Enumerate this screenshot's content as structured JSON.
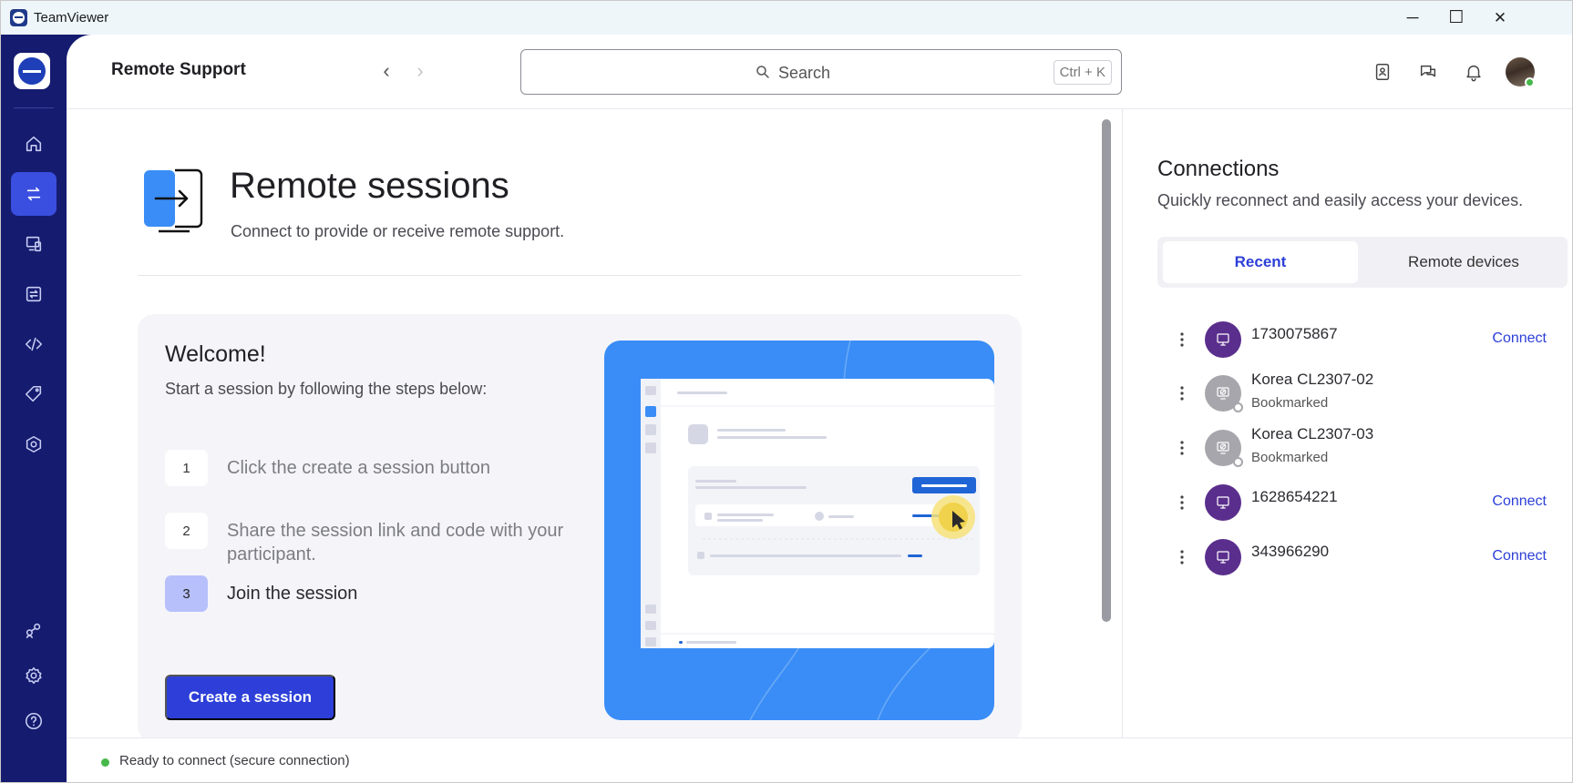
{
  "window": {
    "app_title": "TeamViewer",
    "minimize_glyph": "─",
    "maximize_glyph": "☐",
    "close_glyph": "✕"
  },
  "header": {
    "page_title": "Remote Support",
    "back_glyph": "‹",
    "forward_glyph": "›",
    "search_placeholder": "Search",
    "search_shortcut": "Ctrl + K"
  },
  "nav": {
    "items": [
      {
        "name": "home-icon",
        "active": false
      },
      {
        "name": "remote-support-icon",
        "active": true
      },
      {
        "name": "devices-icon",
        "active": false
      },
      {
        "name": "remote-access-icon",
        "active": false
      },
      {
        "name": "code-icon",
        "active": false
      },
      {
        "name": "tag-icon",
        "active": false
      },
      {
        "name": "security-icon",
        "active": false
      },
      {
        "name": "integrations-icon",
        "active": false
      },
      {
        "name": "settings-icon",
        "active": false
      },
      {
        "name": "help-icon",
        "active": false
      }
    ]
  },
  "hero": {
    "title": "Remote sessions",
    "subtitle": "Connect to provide or receive remote support."
  },
  "welcome": {
    "title": "Welcome!",
    "subtitle": "Start a session by following the steps below:",
    "steps": [
      {
        "number": "1",
        "text": "Click the create a session button"
      },
      {
        "number": "2",
        "text": "Share the session link and code with your participant."
      },
      {
        "number": "3",
        "text": "Join the session"
      }
    ],
    "create_button": "Create a session"
  },
  "connections": {
    "title": "Connections",
    "subtitle": "Quickly reconnect and easily access your devices.",
    "tabs": {
      "recent": "Recent",
      "remote_devices": "Remote devices"
    },
    "devices": [
      {
        "name": "1730075867",
        "sub": "",
        "connect": "Connect",
        "online": true
      },
      {
        "name": "Korea CL2307-02",
        "sub": "Bookmarked",
        "connect": "",
        "online": false
      },
      {
        "name": "Korea CL2307-03",
        "sub": "Bookmarked",
        "connect": "",
        "online": false
      },
      {
        "name": "1628654221",
        "sub": "",
        "connect": "Connect",
        "online": true
      },
      {
        "name": "343966290",
        "sub": "",
        "connect": "Connect",
        "online": true
      }
    ]
  },
  "status": {
    "text": "Ready to connect (secure connection)"
  },
  "colors": {
    "nav_bg": "#151b6e",
    "accent": "#2d3fd8",
    "device_online": "#5a2e8c",
    "status_green": "#46b94a"
  }
}
